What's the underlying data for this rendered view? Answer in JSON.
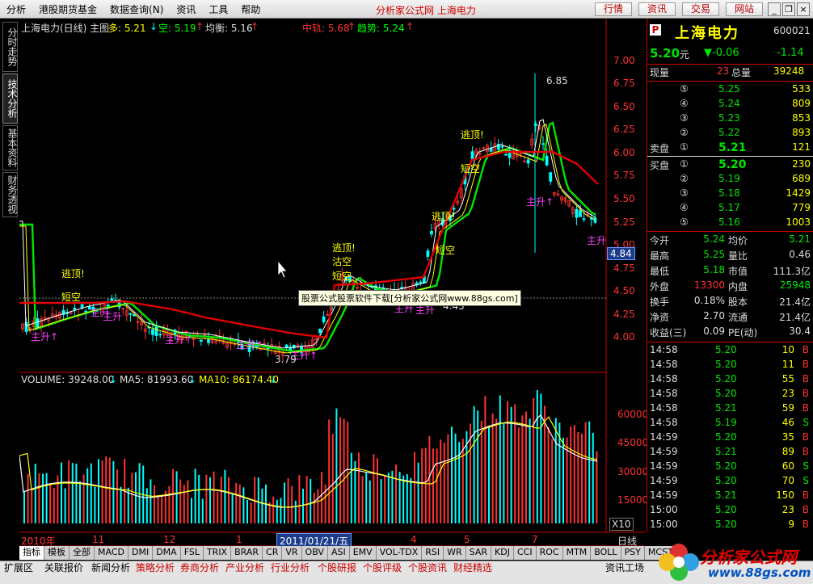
{
  "menu": {
    "items": [
      "分析",
      "港股期货基金",
      "数据查询(N)",
      "资讯",
      "工具",
      "帮助"
    ],
    "app_title": "分析家公式网 上海电力",
    "buttons": [
      "行情",
      "资讯",
      "交易",
      "网站"
    ]
  },
  "left_tabs": [
    "分时走势",
    "技术分析",
    "基本资料",
    "财务透视"
  ],
  "chart_header": {
    "stock": "上海电力(日线) 主图",
    "duo": "多: 5.21",
    "kong": "空: 5.19",
    "junheng": "均衡: 5.16",
    "zhonggui": "中轨: 5.68",
    "qushi": "趋势: 5.24"
  },
  "signals": {
    "escape_top": "逃顶!",
    "short_empty": "短空",
    "main_rise": "主升",
    "main_rise_arrow": "主升↑",
    "sell_empty": "沽空",
    "low": "3.79",
    "high": "6.85",
    "cross": "4.45"
  },
  "price_ticks": [
    "7.00",
    "6.75",
    "6.50",
    "6.25",
    "6.00",
    "5.75",
    "5.50",
    "5.25",
    "5.00",
    "4.84",
    "4.75",
    "4.50",
    "4.25",
    "4.00"
  ],
  "watermark": "股票公式股票软件下载[分析家公式网www.88gs.com]",
  "vol_header": {
    "volume": "VOLUME: 39248.00",
    "ma5": "MA5: 81993.60",
    "ma10": "MA10: 86174.40"
  },
  "vol_ticks": [
    "60000",
    "45000",
    "30000",
    "15000",
    "X10"
  ],
  "time_axis": {
    "labels": [
      "2010年",
      "11",
      "12",
      "1",
      "4",
      "5",
      "7"
    ],
    "cursor": "2011/01/21/五",
    "period": "日线",
    "zoom": [
      "+",
      "-",
      "0"
    ]
  },
  "tabs": [
    "指标",
    "模板",
    "全部",
    "MACD",
    "DMI",
    "DMA",
    "FSL",
    "TRIX",
    "BRAR",
    "CR",
    "VR",
    "OBV",
    "ASI",
    "EMV",
    "VOL-TDX",
    "RSI",
    "WR",
    "SAR",
    "KDJ",
    "CCI",
    "ROC",
    "MTM",
    "BOLL",
    "PSY",
    "MCST"
  ],
  "bottom": [
    "扩展区",
    "关联报价",
    "新闻分析",
    "策略分析",
    "券商分析",
    "产业分析",
    "行业分析",
    "个股研报",
    "个股评级",
    "个股资讯",
    "财经精选",
    "资讯工场"
  ],
  "logo": {
    "text": "分析家公式网",
    "url": "www.88gs.com"
  },
  "quote": {
    "badge": "P",
    "name": "上海电力",
    "code": "600021",
    "price": "5.20",
    "unit": "元",
    "change": "▼-0.06",
    "pct": "-1.14",
    "cur_vol_label": "现量",
    "cur_vol": "23",
    "total_label": "总量",
    "total_vol": "39248",
    "sell": [
      {
        "n": "⑤",
        "p": "5.25",
        "v": "533"
      },
      {
        "n": "④",
        "p": "5.24",
        "v": "809"
      },
      {
        "n": "③",
        "p": "5.23",
        "v": "853"
      },
      {
        "n": "②",
        "p": "5.22",
        "v": "893"
      },
      {
        "label": "卖盘",
        "n": "①",
        "p": "5.21",
        "v": "121"
      }
    ],
    "buy": [
      {
        "label": "买盘",
        "n": "①",
        "p": "5.20",
        "v": "230"
      },
      {
        "n": "②",
        "p": "5.19",
        "v": "689"
      },
      {
        "n": "③",
        "p": "5.18",
        "v": "1429"
      },
      {
        "n": "④",
        "p": "5.17",
        "v": "779"
      },
      {
        "n": "⑤",
        "p": "5.16",
        "v": "1003"
      }
    ],
    "stats": [
      [
        "今开",
        "5.24",
        "均价",
        "5.21"
      ],
      [
        "最高",
        "5.25",
        "量比",
        "0.46"
      ],
      [
        "最低",
        "5.18",
        "市值",
        "111.3亿"
      ],
      [
        "外盘",
        "13300",
        "内盘",
        "25948"
      ],
      [
        "换手",
        "0.18%",
        "股本",
        "21.4亿"
      ],
      [
        "净资",
        "2.70",
        "流通",
        "21.4亿"
      ],
      [
        "收益(三)",
        "0.09",
        "PE(动)",
        "30.4"
      ]
    ],
    "ticks": [
      [
        "14:58",
        "5.20",
        "10",
        "B"
      ],
      [
        "14:58",
        "5.20",
        "11",
        "B"
      ],
      [
        "14:58",
        "5.20",
        "55",
        "B"
      ],
      [
        "14:58",
        "5.20",
        "23",
        "B"
      ],
      [
        "14:58",
        "5.21",
        "59",
        "B"
      ],
      [
        "14:58",
        "5.19",
        "46",
        "S"
      ],
      [
        "14:59",
        "5.20",
        "35",
        "B"
      ],
      [
        "14:59",
        "5.21",
        "89",
        "B"
      ],
      [
        "14:59",
        "5.20",
        "60",
        "S"
      ],
      [
        "14:59",
        "5.20",
        "70",
        "S"
      ],
      [
        "14:59",
        "5.21",
        "150",
        "B"
      ],
      [
        "15:00",
        "5.20",
        "23",
        "B"
      ],
      [
        "15:00",
        "5.20",
        "9",
        "B"
      ]
    ]
  },
  "colors": {
    "up": "#ff3232",
    "down": "#00e600",
    "yellow": "#ffff00",
    "cyan": "#00ffff",
    "magenta": "#ff40ff"
  }
}
